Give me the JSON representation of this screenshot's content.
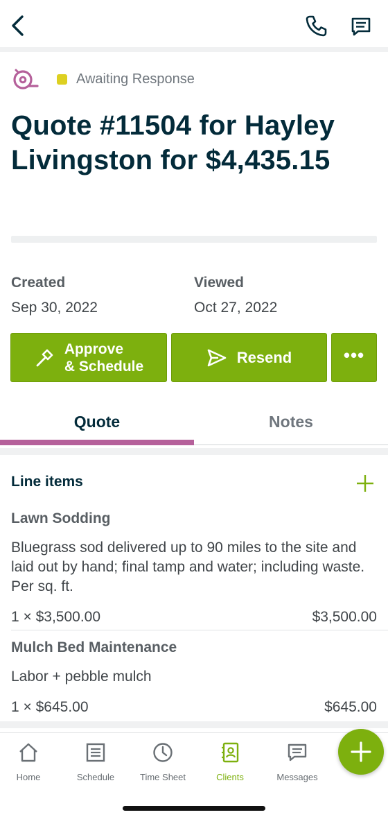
{
  "status": {
    "label": "Awaiting Response",
    "color": "#ddd021"
  },
  "title": "Quote #11504 for Hayley Livingston for $4,435.15",
  "meta": {
    "created_label": "Created",
    "created_value": "Sep 30, 2022",
    "viewed_label": "Viewed",
    "viewed_value": "Oct 27, 2022"
  },
  "actions": {
    "approve_line1": "Approve",
    "approve_line2": "& Schedule",
    "resend": "Resend",
    "more": "•••"
  },
  "tabs": [
    {
      "label": "Quote",
      "active": true
    },
    {
      "label": "Notes",
      "active": false
    }
  ],
  "line_items": {
    "header": "Line items",
    "items": [
      {
        "name": "Lawn Sodding",
        "description": "Bluegrass sod delivered up to 90 miles to the site and laid out by hand; final tamp and water; including waste. Per sq. ft.",
        "qty_price": "1 × $3,500.00",
        "total": "$3,500.00"
      },
      {
        "name": "Mulch Bed Maintenance",
        "description": "Labor + pebble mulch",
        "qty_price": "1 × $645.00",
        "total": "$645.00"
      }
    ]
  },
  "bottom_nav": [
    {
      "label": "Home",
      "icon": "home-icon"
    },
    {
      "label": "Schedule",
      "icon": "schedule-icon"
    },
    {
      "label": "Time Sheet",
      "icon": "clock-icon"
    },
    {
      "label": "Clients",
      "icon": "clients-icon",
      "active": true
    },
    {
      "label": "Messages",
      "icon": "messages-icon"
    }
  ],
  "colors": {
    "brand_green": "#7db00e",
    "accent_pink": "#b5609a",
    "heading_navy": "#032b3a"
  }
}
